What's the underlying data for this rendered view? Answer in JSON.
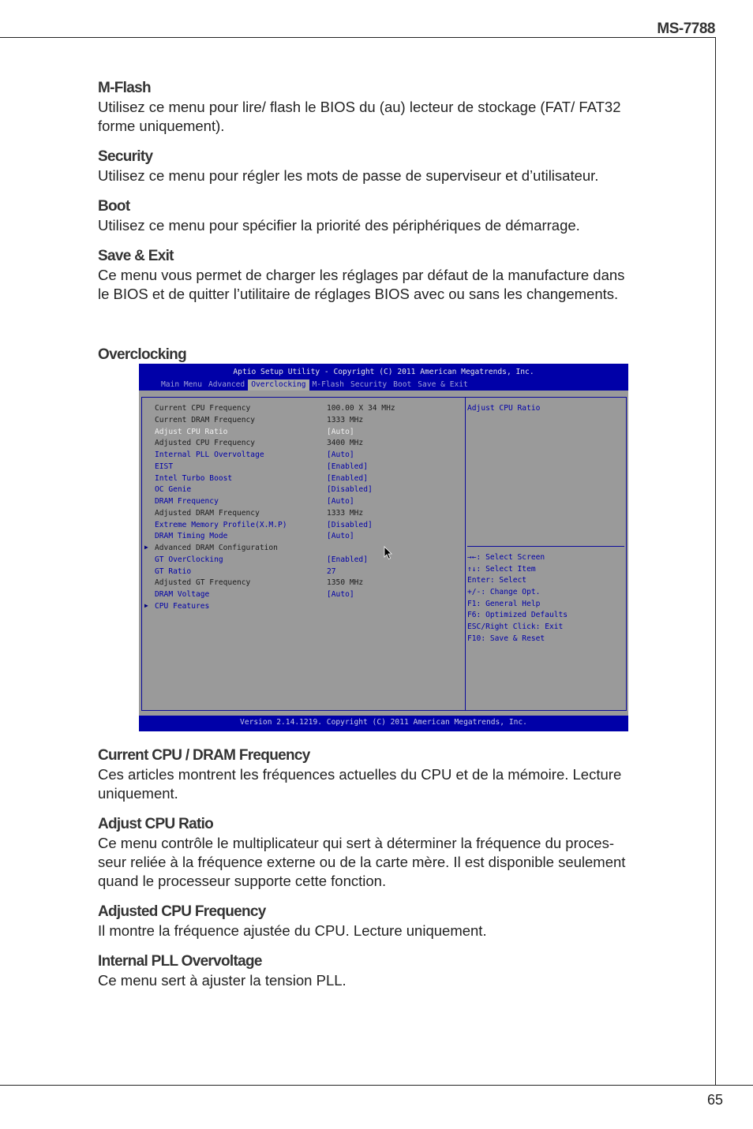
{
  "header": {
    "model": "MS-7788"
  },
  "footer": {
    "page_number": "65"
  },
  "sections_top": [
    {
      "title": "M-Flash",
      "lines": [
        "Utilisez ce menu pour lire/ flash le BIOS du (au) lecteur de stockage (FAT/ FAT32",
        "forme uniquement)."
      ]
    },
    {
      "title": "Security",
      "lines": [
        "Utilisez ce menu pour régler les mots de passe de superviseur et d’utilisateur."
      ]
    },
    {
      "title": "Boot",
      "lines": [
        "Utilisez ce menu pour spécifier la priorité des périphériques de démarrage."
      ]
    },
    {
      "title": "Save & Exit",
      "lines": [
        "Ce menu vous permet de charger les réglages par défaut de la manufacture dans",
        "le BIOS et de quitter l’utilitaire de réglages BIOS avec ou sans les changements."
      ]
    }
  ],
  "overclocking_title": "Overclocking",
  "bios": {
    "title": "Aptio Setup Utility - Copyright (C) 2011 American Megatrends, Inc.",
    "tabs": [
      "Main Menu",
      "Advanced",
      "Overclocking",
      "M-Flash",
      "Security",
      "Boot",
      "Save & Exit"
    ],
    "active_tab": "Overclocking",
    "items": [
      {
        "label": "Current CPU Frequency",
        "value": "100.00 X 34 MHz",
        "type": "info"
      },
      {
        "label": "Current DRAM Frequency",
        "value": "1333 MHz",
        "type": "info"
      },
      {
        "label": "Adjust CPU Ratio",
        "value": "[Auto]",
        "type": "selected"
      },
      {
        "label": "Adjusted CPU Frequency",
        "value": "3400 MHz",
        "type": "info"
      },
      {
        "label": "Internal PLL Overvoltage",
        "value": "[Auto]",
        "type": "option"
      },
      {
        "label": "EIST",
        "value": "[Enabled]",
        "type": "option"
      },
      {
        "label": "Intel Turbo Boost",
        "value": "[Enabled]",
        "type": "option"
      },
      {
        "label": "OC Genie",
        "value": "[Disabled]",
        "type": "option"
      },
      {
        "label": "DRAM Frequency",
        "value": "[Auto]",
        "type": "option"
      },
      {
        "label": "Adjusted DRAM Frequency",
        "value": "1333 MHz",
        "type": "info"
      },
      {
        "label": "Extreme Memory Profile(X.M.P)",
        "value": "[Disabled]",
        "type": "option"
      },
      {
        "label": "DRAM Timing Mode",
        "value": "[Auto]",
        "type": "option"
      },
      {
        "label": "Advanced DRAM Configuration",
        "value": "",
        "type": "submenu"
      },
      {
        "label": "GT OverClocking",
        "value": "[Enabled]",
        "type": "option"
      },
      {
        "label": "GT Ratio",
        "value": "27",
        "type": "option"
      },
      {
        "label": "Adjusted GT Frequency",
        "value": "1350 MHz",
        "type": "info"
      },
      {
        "label": "DRAM Voltage",
        "value": "[Auto]",
        "type": "option"
      },
      {
        "label": "CPU Features",
        "value": "",
        "type": "submenu-option"
      }
    ],
    "help_text": "Adjust CPU Ratio",
    "keys": [
      "→←: Select Screen",
      "↑↓: Select Item",
      "Enter: Select",
      "+/-: Change Opt.",
      "F1: General Help",
      "F6: Optimized Defaults",
      "ESC/Right Click: Exit",
      "F10: Save & Reset"
    ],
    "version": "Version 2.14.1219. Copyright (C) 2011 American Megatrends, Inc."
  },
  "sections_bottom": [
    {
      "title": "Current CPU / DRAM Frequency",
      "lines": [
        "Ces articles montrent les fréquences actuelles du CPU et de la mémoire. Lecture",
        "uniquement."
      ]
    },
    {
      "title": "Adjust CPU Ratio",
      "lines": [
        "Ce menu contrôle le multiplicateur qui sert à déterminer la fréquence du proces-",
        "seur reliée à la fréquence externe ou de la carte mère. Il est disponible seulement",
        "quand le processeur supporte cette fonction."
      ]
    },
    {
      "title": "Adjusted CPU Frequency",
      "lines": [
        "Il montre la fréquence ajustée du CPU. Lecture uniquement."
      ]
    },
    {
      "title": "Internal PLL Overvoltage",
      "lines": [
        "Ce menu sert à ajuster la tension PLL."
      ]
    }
  ]
}
